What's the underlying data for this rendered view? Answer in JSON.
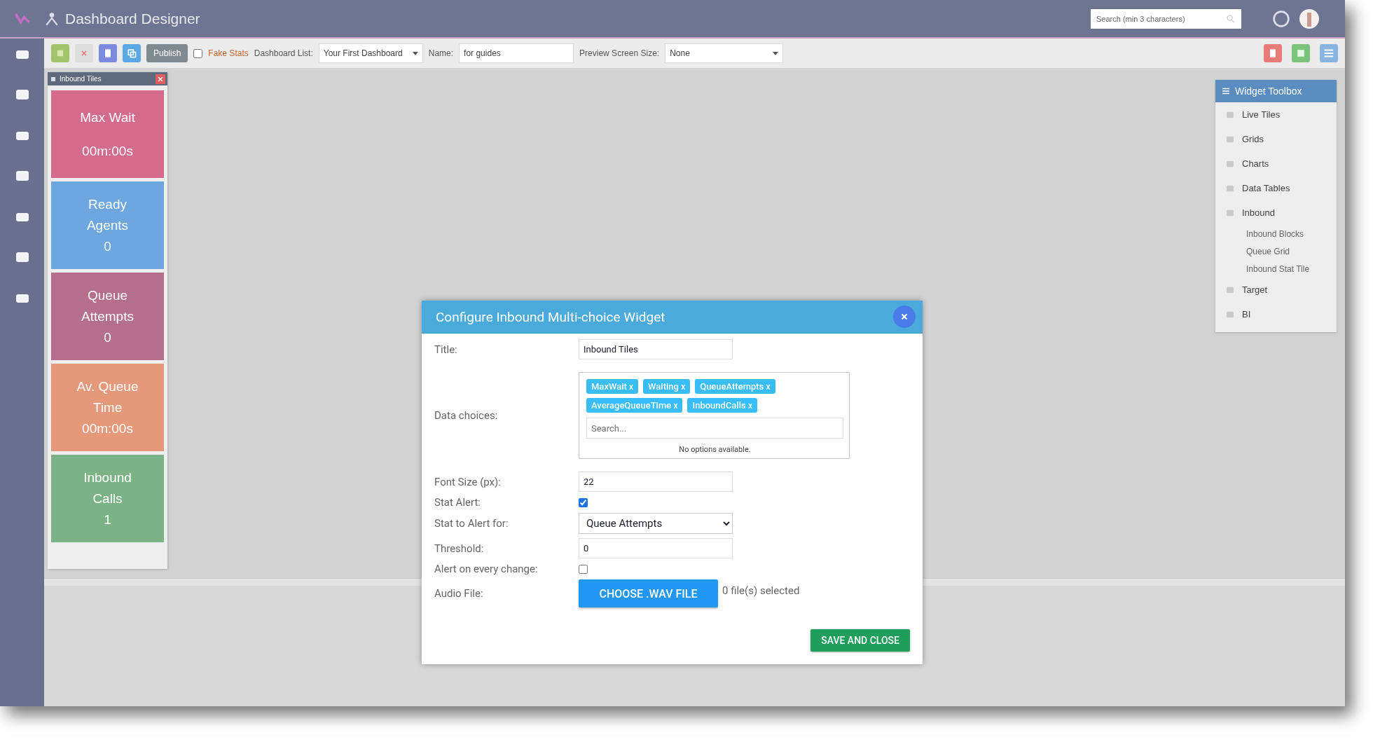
{
  "app": {
    "title": "Dashboard Designer",
    "search": {
      "placeholder": "Search (min 3 characters)"
    }
  },
  "toolbar": {
    "publish": "Publish",
    "fake_stats": {
      "label": "Fake Stats",
      "checked": false
    },
    "dashboard_list": {
      "label": "Dashboard List:",
      "value": "Your First Dashboard"
    },
    "name": {
      "label": "Name:",
      "value": "for guides"
    },
    "preview": {
      "label": "Preview Screen Size:",
      "value": "None"
    }
  },
  "tiles_panel": {
    "title": "Inbound Tiles",
    "tiles": [
      {
        "lines": [
          "Max Wait",
          "00m:00s"
        ],
        "color": "#d46b8c"
      },
      {
        "lines": [
          "Ready",
          "Agents",
          "0"
        ],
        "color": "#6ea6e0"
      },
      {
        "lines": [
          "Queue",
          "Attempts",
          "0"
        ],
        "color": "#b56f8d"
      },
      {
        "lines": [
          "Av. Queue",
          "Time",
          "00m:00s"
        ],
        "color": "#e5987a"
      },
      {
        "lines": [
          "Inbound",
          "Calls",
          "1"
        ],
        "color": "#7cb386"
      }
    ]
  },
  "toolbox": {
    "title": "Widget Toolbox",
    "items": [
      {
        "label": "Live Tiles",
        "kind": "item"
      },
      {
        "label": "Grids",
        "kind": "item"
      },
      {
        "label": "Charts",
        "kind": "item"
      },
      {
        "label": "Data Tables",
        "kind": "item"
      },
      {
        "label": "Inbound",
        "kind": "item"
      },
      {
        "label": "Inbound Blocks",
        "kind": "sub"
      },
      {
        "label": "Queue Grid",
        "kind": "sub"
      },
      {
        "label": "Inbound Stat Tile",
        "kind": "sub"
      },
      {
        "label": "Target",
        "kind": "item"
      },
      {
        "label": "BI",
        "kind": "item"
      }
    ]
  },
  "dialog": {
    "title": "Configure Inbound Multi-choice Widget",
    "title_field": {
      "label": "Title:",
      "value": "Inbound Tiles"
    },
    "data_choices": {
      "label": "Data choices:",
      "tags": [
        {
          "label": "MaxWait",
          "remove": "x"
        },
        {
          "label": "Waiting",
          "remove": "x"
        },
        {
          "label": "QueueAttempts",
          "remove": "x"
        },
        {
          "label": "AverageQueueTime",
          "remove": "x"
        },
        {
          "label": "InboundCalls",
          "remove": "x"
        }
      ],
      "search_placeholder": "Search...",
      "empty": "No options available."
    },
    "font_size": {
      "label": "Font Size (px):",
      "value": "22"
    },
    "stat_alert": {
      "label": "Stat Alert:",
      "checked": true
    },
    "stat_to_alert": {
      "label": "Stat to Alert for:",
      "value": "Queue Attempts"
    },
    "threshold": {
      "label": "Threshold:",
      "value": "0"
    },
    "alert_every_change": {
      "label": "Alert on every change:",
      "checked": false
    },
    "audio_file": {
      "label": "Audio File:",
      "button": "CHOOSE .WAV FILE",
      "status": "0 file(s) selected"
    },
    "save": "SAVE AND CLOSE"
  }
}
